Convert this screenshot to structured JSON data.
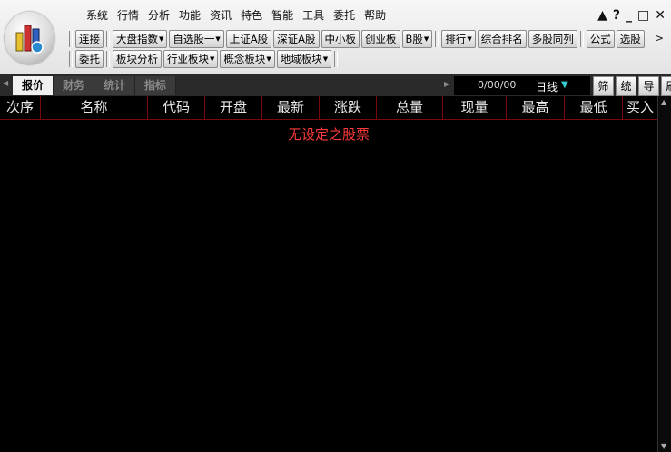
{
  "menu": [
    "系统",
    "行情",
    "分析",
    "功能",
    "资讯",
    "特色",
    "智能",
    "工具",
    "委托",
    "帮助"
  ],
  "window_controls": {
    "restore": "▲",
    "help": "?",
    "minimize": "_",
    "maximize": "□",
    "close": "✕"
  },
  "toolbar1": {
    "connect": "连接",
    "market_index": "大盘指数",
    "my_stocks": "自选股一",
    "sh_a": "上证A股",
    "sz_a": "深证A股",
    "sme": "中小板",
    "gem": "创业板",
    "b_shares": "B股",
    "ranking": "排行",
    "comprehensive_rank": "综合排名",
    "multi_stock": "多股同列",
    "formula": "公式",
    "stock_picker": "选股",
    "more": ">"
  },
  "toolbar2": {
    "entrust": "委托",
    "sector_analysis": "板块分析",
    "industry_sector": "行业板块",
    "concept_sector": "概念板块",
    "region_sector": "地域板块"
  },
  "tabs": [
    "报价",
    "财务",
    "统计",
    "指标"
  ],
  "active_tab": "报价",
  "date_display": "0/00/00",
  "period": "日线",
  "right_buttons": [
    "筛",
    "统",
    "导",
    "刷"
  ],
  "columns": [
    "次序",
    "名称",
    "代码",
    "开盘",
    "最新",
    "涨跌",
    "总量",
    "现量",
    "最高",
    "最低",
    "买入"
  ],
  "empty_message": "无设定之股票",
  "colors": {
    "accent_red": "#ff3a3a",
    "grid_red": "#7a0a0a",
    "header_text": "#e8e8e8",
    "period_arrow": "#3cc"
  }
}
